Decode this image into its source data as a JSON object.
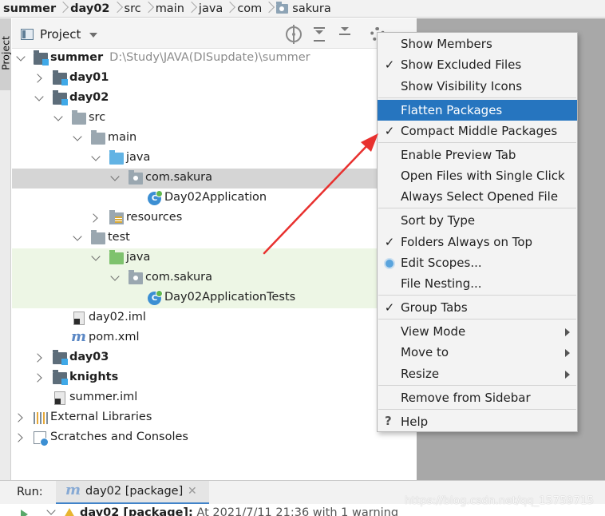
{
  "breadcrumb": [
    "summer",
    "day02",
    "src",
    "main",
    "java",
    "com",
    "sakura"
  ],
  "left_strip": {
    "tab_label": "Project"
  },
  "project_header": {
    "title": "Project"
  },
  "tree": {
    "root": {
      "name": "summer",
      "path": "D:\\Study\\JAVA(DISupdate)\\summer"
    },
    "day01": "day01",
    "day02": "day02",
    "src": "src",
    "main": "main",
    "java_main": "java",
    "pkg_main": "com.sakura",
    "class_main": "Day02Application",
    "resources": "resources",
    "test": "test",
    "java_test": "java",
    "pkg_test": "com.sakura",
    "class_test": "Day02ApplicationTests",
    "iml_day02": "day02.iml",
    "pom": "pom.xml",
    "day03": "day03",
    "knights": "knights",
    "iml_summer": "summer.iml",
    "ext_libs": "External Libraries",
    "scratches": "Scratches and Consoles"
  },
  "class_icon_letter": "C",
  "maven_glyph": "m",
  "menu": {
    "show_members": "Show Members",
    "show_excluded": "Show Excluded Files",
    "show_visibility": "Show Visibility Icons",
    "flatten_packages": "Flatten Packages",
    "compact_middle": "Compact Middle Packages",
    "enable_preview": "Enable Preview Tab",
    "open_single_click": "Open Files with Single Click",
    "always_select": "Always Select Opened File",
    "sort_by_type": "Sort by Type",
    "folders_on_top": "Folders Always on Top",
    "edit_scopes": "Edit Scopes...",
    "file_nesting": "File Nesting...",
    "group_tabs": "Group Tabs",
    "view_mode": "View Mode",
    "move_to": "Move to",
    "resize": "Resize",
    "remove_sidebar": "Remove from Sidebar",
    "help": "Help",
    "check_glyph": "✓",
    "help_glyph": "?"
  },
  "run": {
    "label": "Run:",
    "tab_label": "day02 [package]",
    "close_glyph": "✕",
    "line_name": "day02 [package]:",
    "line_rest": "At 2021/7/11 21:36 with 1 warning"
  },
  "watermark": "https://blog.csdn.net/qq_15759715",
  "colors": {
    "selection": "#2675bf",
    "test_bg": "#edf6e5",
    "selected_row": "#d5d5d5",
    "arrow": "#e8312f"
  }
}
